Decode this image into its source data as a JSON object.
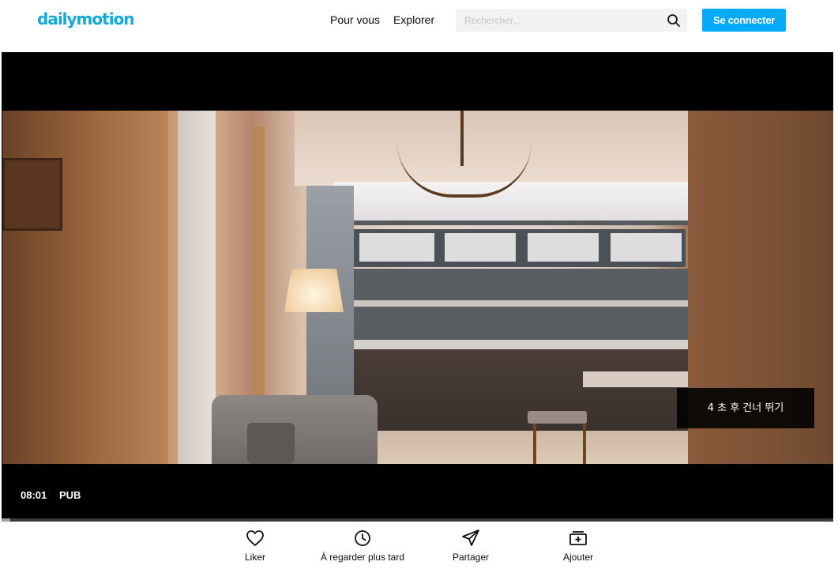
{
  "header": {
    "logo_text": "dailymotion",
    "nav": [
      "Pour vous",
      "Explorer"
    ],
    "search_placeholder": "Rechercher...",
    "search_icon": "search-icon",
    "login_label": "Se connecter",
    "accent_color": "#00aaff"
  },
  "player": {
    "skip_label": "4 초 후 건너 뛰기",
    "time": "08:01",
    "ad_label": "PUB",
    "progress": 0.01
  },
  "actions": [
    {
      "label": "Liker",
      "icon": "heart-icon"
    },
    {
      "label": "À regarder plus tard",
      "icon": "clock-icon"
    },
    {
      "label": "Partager",
      "icon": "send-icon"
    },
    {
      "label": "Ajouter",
      "icon": "add-to-playlist-icon"
    }
  ]
}
